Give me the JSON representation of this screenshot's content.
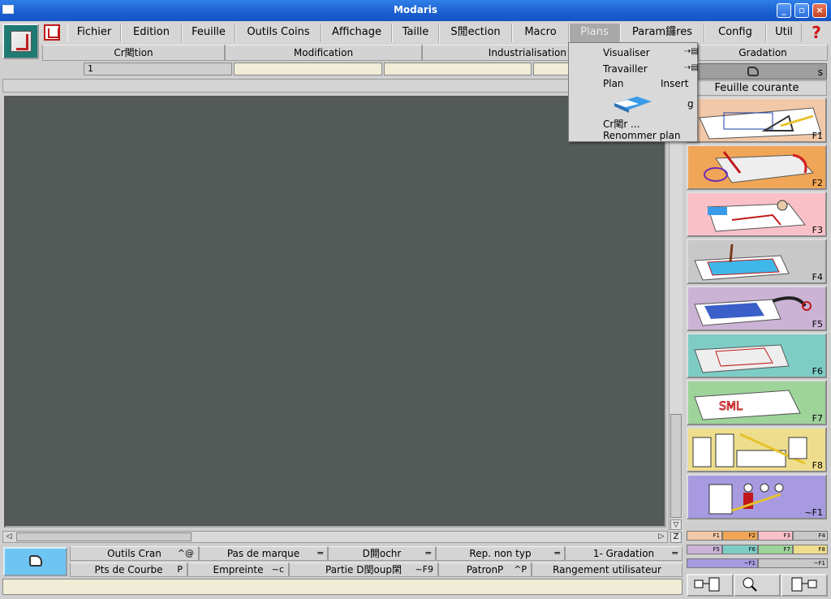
{
  "window": {
    "title": "Modaris"
  },
  "menu": {
    "items": [
      "Fichier",
      "Edition",
      "Feuille",
      "Outils Coins",
      "Affichage",
      "Taille",
      "S閒ection",
      "Macro",
      "Plans",
      "Param鑼res",
      "Config",
      "Util"
    ],
    "help": "?"
  },
  "tabs2": [
    "Cr閐tion",
    "Modification",
    "Industrialisation",
    "Gradation"
  ],
  "fields": {
    "first": "1"
  },
  "plans_menu": {
    "visualiser": "Visualiser",
    "travailler": "Travailler",
    "plan": "Plan",
    "plan_acc": "Insert",
    "eraser_acc": "g",
    "creer": "Cr閐r ...",
    "renommer": "Renommer plan"
  },
  "right_panel": {
    "top_letter": "s",
    "feuille_courante": "Feuille courante",
    "fkeys": [
      "F1",
      "F2",
      "F3",
      "F4",
      "F5",
      "F6",
      "F7",
      "F8",
      "~F1"
    ],
    "colors": [
      "#f2c9a8",
      "#f0a656",
      "#f9c0c8",
      "#c8c8c8",
      "#cbb3d6",
      "#7dcdc6",
      "#9ed39a",
      "#eedd8d",
      "#a79ae0"
    ]
  },
  "bottom_tools": {
    "row1": [
      {
        "label": "Outils Cran",
        "shortcut": "^@"
      },
      {
        "label": "Pas de marque",
        "shortcut": ""
      },
      {
        "label": "D閞ochr",
        "shortcut": ""
      },
      {
        "label": "Rep. non typ",
        "shortcut": ""
      },
      {
        "label": "1- Gradation",
        "shortcut": ""
      }
    ],
    "row2": [
      {
        "label": "Pts de Courbe",
        "shortcut": "P"
      },
      {
        "label": "Empreinte",
        "shortcut": "~c"
      },
      {
        "label": "Partie D閏oup閑",
        "shortcut": "~F9"
      },
      {
        "label": "PatronP",
        "shortcut": "^P"
      },
      {
        "label": "Rangement utilisateur",
        "shortcut": ""
      }
    ]
  },
  "chips": {
    "row1": [
      "F1",
      "F2",
      "F3",
      "F4"
    ],
    "row2": [
      "F5",
      "F6",
      "F7",
      "F8"
    ],
    "row3": [
      "~F1",
      "~F1"
    ]
  },
  "scroll": {
    "z_label": "Z"
  }
}
